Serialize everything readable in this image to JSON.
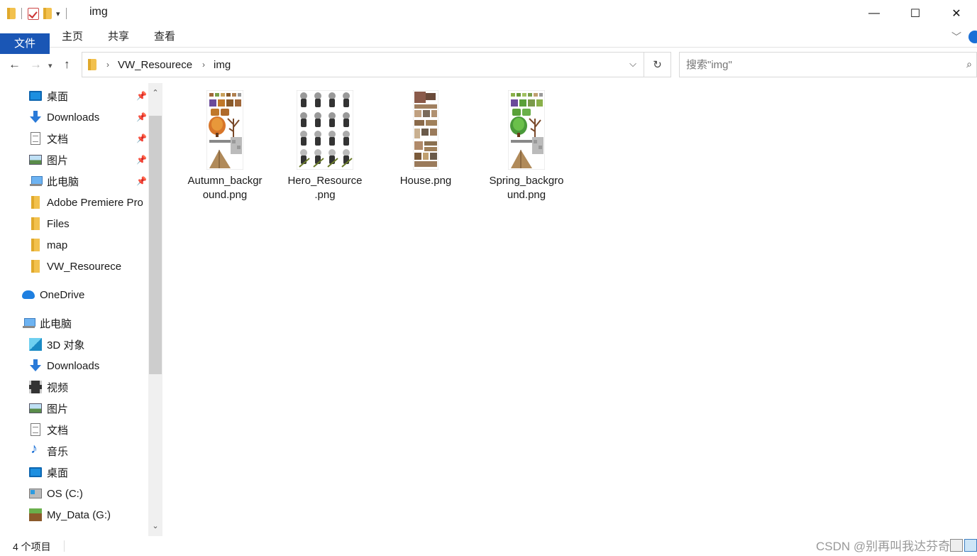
{
  "window": {
    "title": "img",
    "controls": {
      "minimize": "—",
      "maximize": "☐",
      "close": "✕"
    }
  },
  "ribbon": {
    "tabs": [
      "文件",
      "主页",
      "共享",
      "查看"
    ]
  },
  "address": {
    "breadcrumb": [
      "VW_Resourece",
      "img"
    ]
  },
  "search": {
    "placeholder": "搜索\"img\""
  },
  "sidebar": {
    "quick_access": [
      {
        "label": "桌面",
        "icon": "desktop-icon",
        "pinned": true
      },
      {
        "label": "Downloads",
        "icon": "download-icon",
        "pinned": true
      },
      {
        "label": "文档",
        "icon": "document-icon",
        "pinned": true
      },
      {
        "label": "图片",
        "icon": "pictures-icon",
        "pinned": true
      },
      {
        "label": "此电脑",
        "icon": "computer-icon",
        "pinned": true
      },
      {
        "label": "Adobe Premiere Pro",
        "icon": "folder-icon",
        "pinned": false
      },
      {
        "label": "Files",
        "icon": "folder-icon",
        "pinned": false
      },
      {
        "label": "map",
        "icon": "folder-icon",
        "pinned": false
      },
      {
        "label": "VW_Resourece",
        "icon": "folder-icon",
        "pinned": false
      }
    ],
    "onedrive": {
      "label": "OneDrive",
      "icon": "cloud-icon"
    },
    "this_pc": {
      "label": "此电脑",
      "icon": "computer-icon"
    },
    "this_pc_items": [
      {
        "label": "3D 对象",
        "icon": "cube-icon"
      },
      {
        "label": "Downloads",
        "icon": "download-icon"
      },
      {
        "label": "视频",
        "icon": "video-icon"
      },
      {
        "label": "图片",
        "icon": "pictures-icon"
      },
      {
        "label": "文档",
        "icon": "document-icon"
      },
      {
        "label": "音乐",
        "icon": "music-icon"
      },
      {
        "label": "桌面",
        "icon": "desktop-icon"
      },
      {
        "label": "OS (C:)",
        "icon": "drive-icon"
      },
      {
        "label": "My_Data (G:)",
        "icon": "minecraft-drive-icon"
      }
    ]
  },
  "files": [
    {
      "name_line1": "Autumn_backgr",
      "name_line2": "ound.png",
      "thumb": "autumn"
    },
    {
      "name_line1": "Hero_Resource",
      "name_line2": ".png",
      "thumb": "hero"
    },
    {
      "name_line1": "House.png",
      "name_line2": "",
      "thumb": "house"
    },
    {
      "name_line1": "Spring_backgro",
      "name_line2": "und.png",
      "thumb": "spring"
    }
  ],
  "status": {
    "item_count": "4 个项目",
    "watermark": "CSDN @别再叫我达芬奇"
  },
  "colors": {
    "file_tab": "#1a56b5",
    "accent": "#1a6fd6"
  }
}
